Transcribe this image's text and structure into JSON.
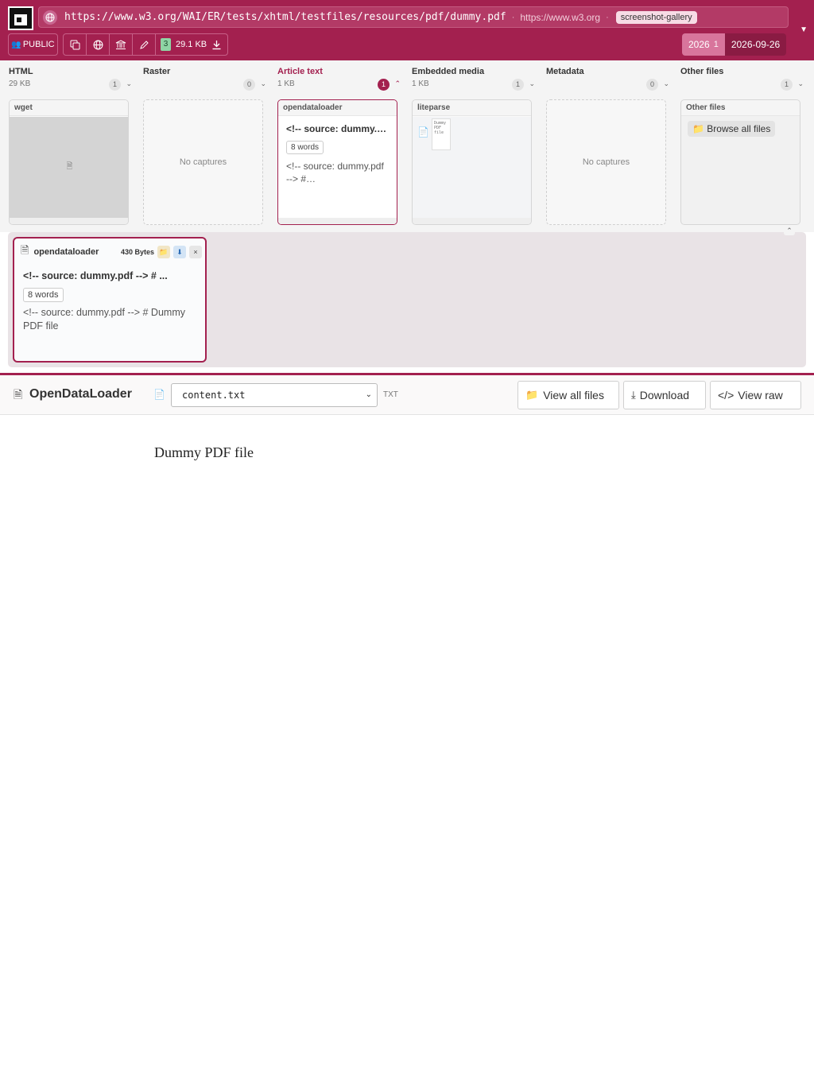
{
  "header": {
    "url": "https://www.w3.org/WAI/ER/tests/xhtml/testfiles/resources/pdf/dummy.pdf",
    "separator": "·",
    "domain": "https://www.w3.org",
    "tag": "screenshot-gallery",
    "public_label": "PUBLIC",
    "snapshot_count": "3",
    "total_size": "29.1 KB",
    "year": "2026",
    "year_count": "1",
    "date": "2026-09-26",
    "colors": {
      "brand": "#a3204f",
      "accent_light": "#d8759c"
    }
  },
  "columns": [
    {
      "title": "HTML",
      "size": "29 KB",
      "count": "1",
      "chevron": "⌄",
      "card_label": "wget"
    },
    {
      "title": "Raster",
      "size": "",
      "count": "0",
      "chevron": "⌄",
      "empty_text": "No captures"
    },
    {
      "title": "Article text",
      "size": "1 KB",
      "count": "1",
      "chevron": "⌃",
      "card_label": "opendataloader",
      "card_title": "<!-- source: dummy.pdf --> # Dummy PDF file",
      "card_words": "8 words",
      "card_body": "<!-- source: dummy.pdf --> #…"
    },
    {
      "title": "Embedded media",
      "size": "1 KB",
      "count": "1",
      "chevron": "⌄",
      "card_label": "liteparse",
      "thumb_text": "Dummy PDF file"
    },
    {
      "title": "Metadata",
      "size": "",
      "count": "0",
      "chevron": "⌄",
      "empty_text": "No captures"
    },
    {
      "title": "Other files",
      "size": "",
      "count": "1",
      "chevron": "⌄",
      "card_label": "Other files",
      "browse_label": "Browse all files"
    }
  ],
  "detail": {
    "name": "opendataloader",
    "size": "430 Bytes",
    "title": "<!-- source: dummy.pdf --> # ...",
    "words": "8 words",
    "body": "<!-- source: dummy.pdf --> # Dummy PDF file",
    "close": "×"
  },
  "viewer": {
    "title": "OpenDataLoader",
    "file_selected": "content.txt",
    "file_type": "TXT",
    "view_all_label": "View all files",
    "download_label": "Download",
    "view_raw_label": "View raw"
  },
  "content": {
    "text": "Dummy PDF file"
  }
}
